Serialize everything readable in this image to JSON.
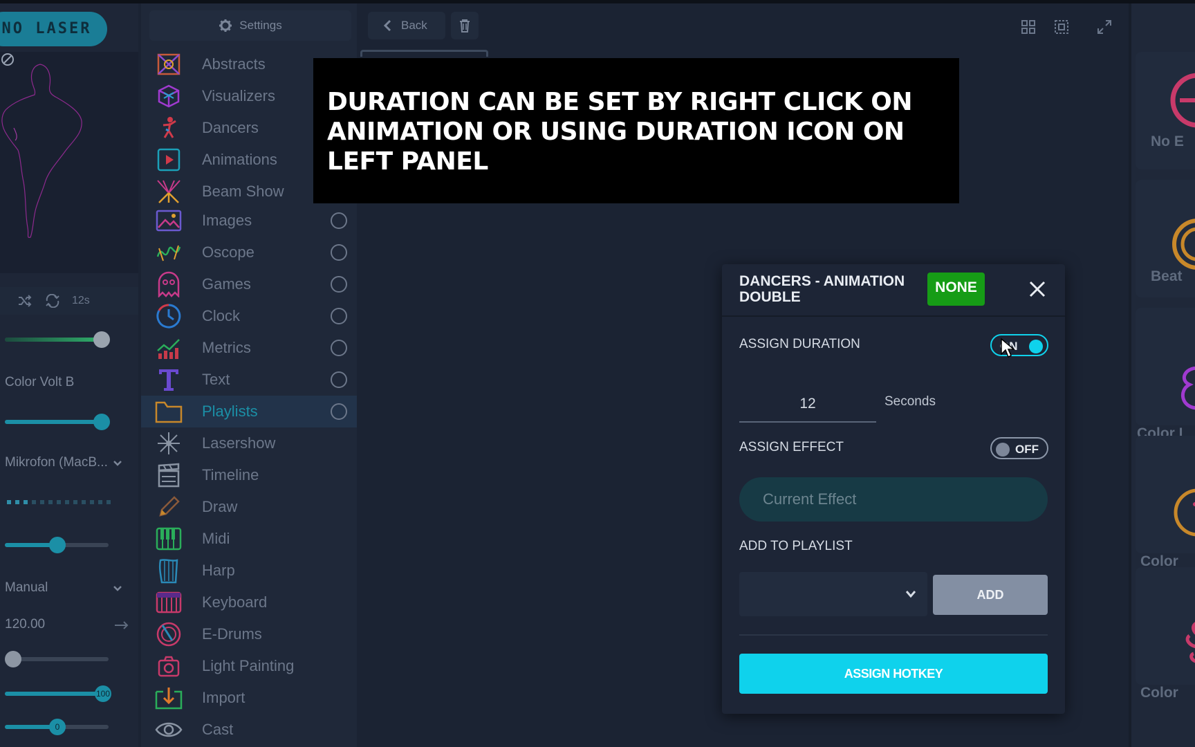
{
  "app": {
    "logo_text": "NO LASER",
    "preview_icons": {
      "block": "block-icon"
    }
  },
  "left_panel": {
    "playback": {
      "shuffle_icon": "shuffle-icon",
      "repeat_icon": "repeat-icon",
      "duration": "12s"
    },
    "slider1": {
      "value": 0.85,
      "fill_color": "#1f9e78"
    },
    "color_label": "Color Volt B",
    "slider2": {
      "value": 0.85,
      "fill_color": "#1b8fa6"
    },
    "audio_device": "Mikrofon (MacB...",
    "level_meter": {
      "active": 3,
      "total": 13
    },
    "slider3": {
      "value": 0.45,
      "fill_color": "#1b8fa6"
    },
    "mode": "Manual",
    "bpm": "120.00",
    "slider4": {
      "value": 0.08,
      "fill_color": "#3a4455"
    },
    "slider5": {
      "value": 1.0,
      "knob_label": "100",
      "fill_color": "#1b8fa6"
    },
    "slider6": {
      "value": 0.45,
      "knob_label": "0",
      "fill_color": "#1b8fa6"
    }
  },
  "categories": {
    "settings_label": "Settings",
    "items": [
      {
        "label": "Abstracts",
        "icon": "abstracts-icon",
        "radio": false,
        "active": false
      },
      {
        "label": "Visualizers",
        "icon": "visualizers-icon",
        "radio": false,
        "active": false
      },
      {
        "label": "Dancers",
        "icon": "dancers-icon",
        "radio": false,
        "active": false
      },
      {
        "label": "Animations",
        "icon": "animations-icon",
        "radio": false,
        "active": false
      },
      {
        "label": "Beam Show",
        "icon": "beam-show-icon",
        "radio": false,
        "active": false
      },
      {
        "label": "Images",
        "icon": "images-icon",
        "radio": true,
        "active": false
      },
      {
        "label": "Oscope",
        "icon": "oscope-icon",
        "radio": true,
        "active": false
      },
      {
        "label": "Games",
        "icon": "games-icon",
        "radio": true,
        "active": false
      },
      {
        "label": "Clock",
        "icon": "clock-icon",
        "radio": true,
        "active": false
      },
      {
        "label": "Metrics",
        "icon": "metrics-icon",
        "radio": true,
        "active": false
      },
      {
        "label": "Text",
        "icon": "text-icon",
        "radio": true,
        "active": false
      },
      {
        "label": "Playlists",
        "icon": "playlists-icon",
        "radio": true,
        "active": true
      },
      {
        "label": "Lasershow",
        "icon": "lasershow-icon",
        "radio": false,
        "active": false
      },
      {
        "label": "Timeline",
        "icon": "timeline-icon",
        "radio": false,
        "active": false
      },
      {
        "label": "Draw",
        "icon": "draw-icon",
        "radio": false,
        "active": false
      },
      {
        "label": "Midi",
        "icon": "midi-icon",
        "radio": false,
        "active": false
      },
      {
        "label": "Harp",
        "icon": "harp-icon",
        "radio": false,
        "active": false
      },
      {
        "label": "Keyboard",
        "icon": "keyboard-icon",
        "radio": false,
        "active": false
      },
      {
        "label": "E-Drums",
        "icon": "e-drums-icon",
        "radio": false,
        "active": false
      },
      {
        "label": "Light Painting",
        "icon": "light-painting-icon",
        "radio": false,
        "active": false
      },
      {
        "label": "Import",
        "icon": "import-icon",
        "radio": false,
        "active": false
      },
      {
        "label": "Cast",
        "icon": "cast-icon",
        "radio": false,
        "active": false
      }
    ]
  },
  "toolbar": {
    "back_label": "Back",
    "icons": [
      "trash-icon",
      "grid-icon",
      "select-icon",
      "fullscreen-icon"
    ]
  },
  "caption": {
    "text": "DURATION CAN BE SET BY RIGHT CLICK ON ANIMATION OR USING DURATION ICON ON LEFT PANEL"
  },
  "right_panel": {
    "items": [
      {
        "label": "No E",
        "icon": "no-effect-icon"
      },
      {
        "label": "Beat",
        "icon": "beat-icon"
      },
      {
        "label": "Color I",
        "icon": "color-effect-icon"
      },
      {
        "label": "Color",
        "icon": "color-effect-icon"
      },
      {
        "label": "Color",
        "icon": "color-effect-icon"
      }
    ]
  },
  "dialog": {
    "title": "DANCERS - ANIMATION DOUBLE",
    "badge": "NONE",
    "badge_color": "#169c16",
    "assign_duration_label": "ASSIGN DURATION",
    "duration_toggle": {
      "label": "ON",
      "state": true
    },
    "duration_value": "12",
    "duration_unit": "Seconds",
    "assign_effect_label": "ASSIGN EFFECT",
    "effect_toggle": {
      "label": "OFF",
      "state": false
    },
    "effect_placeholder": "Current Effect",
    "add_to_playlist_label": "ADD TO PLAYLIST",
    "playlist_select_value": "",
    "add_button": "ADD",
    "hotkey_button": "ASSIGN HOTKEY",
    "accent_color": "#0fd2ec"
  }
}
